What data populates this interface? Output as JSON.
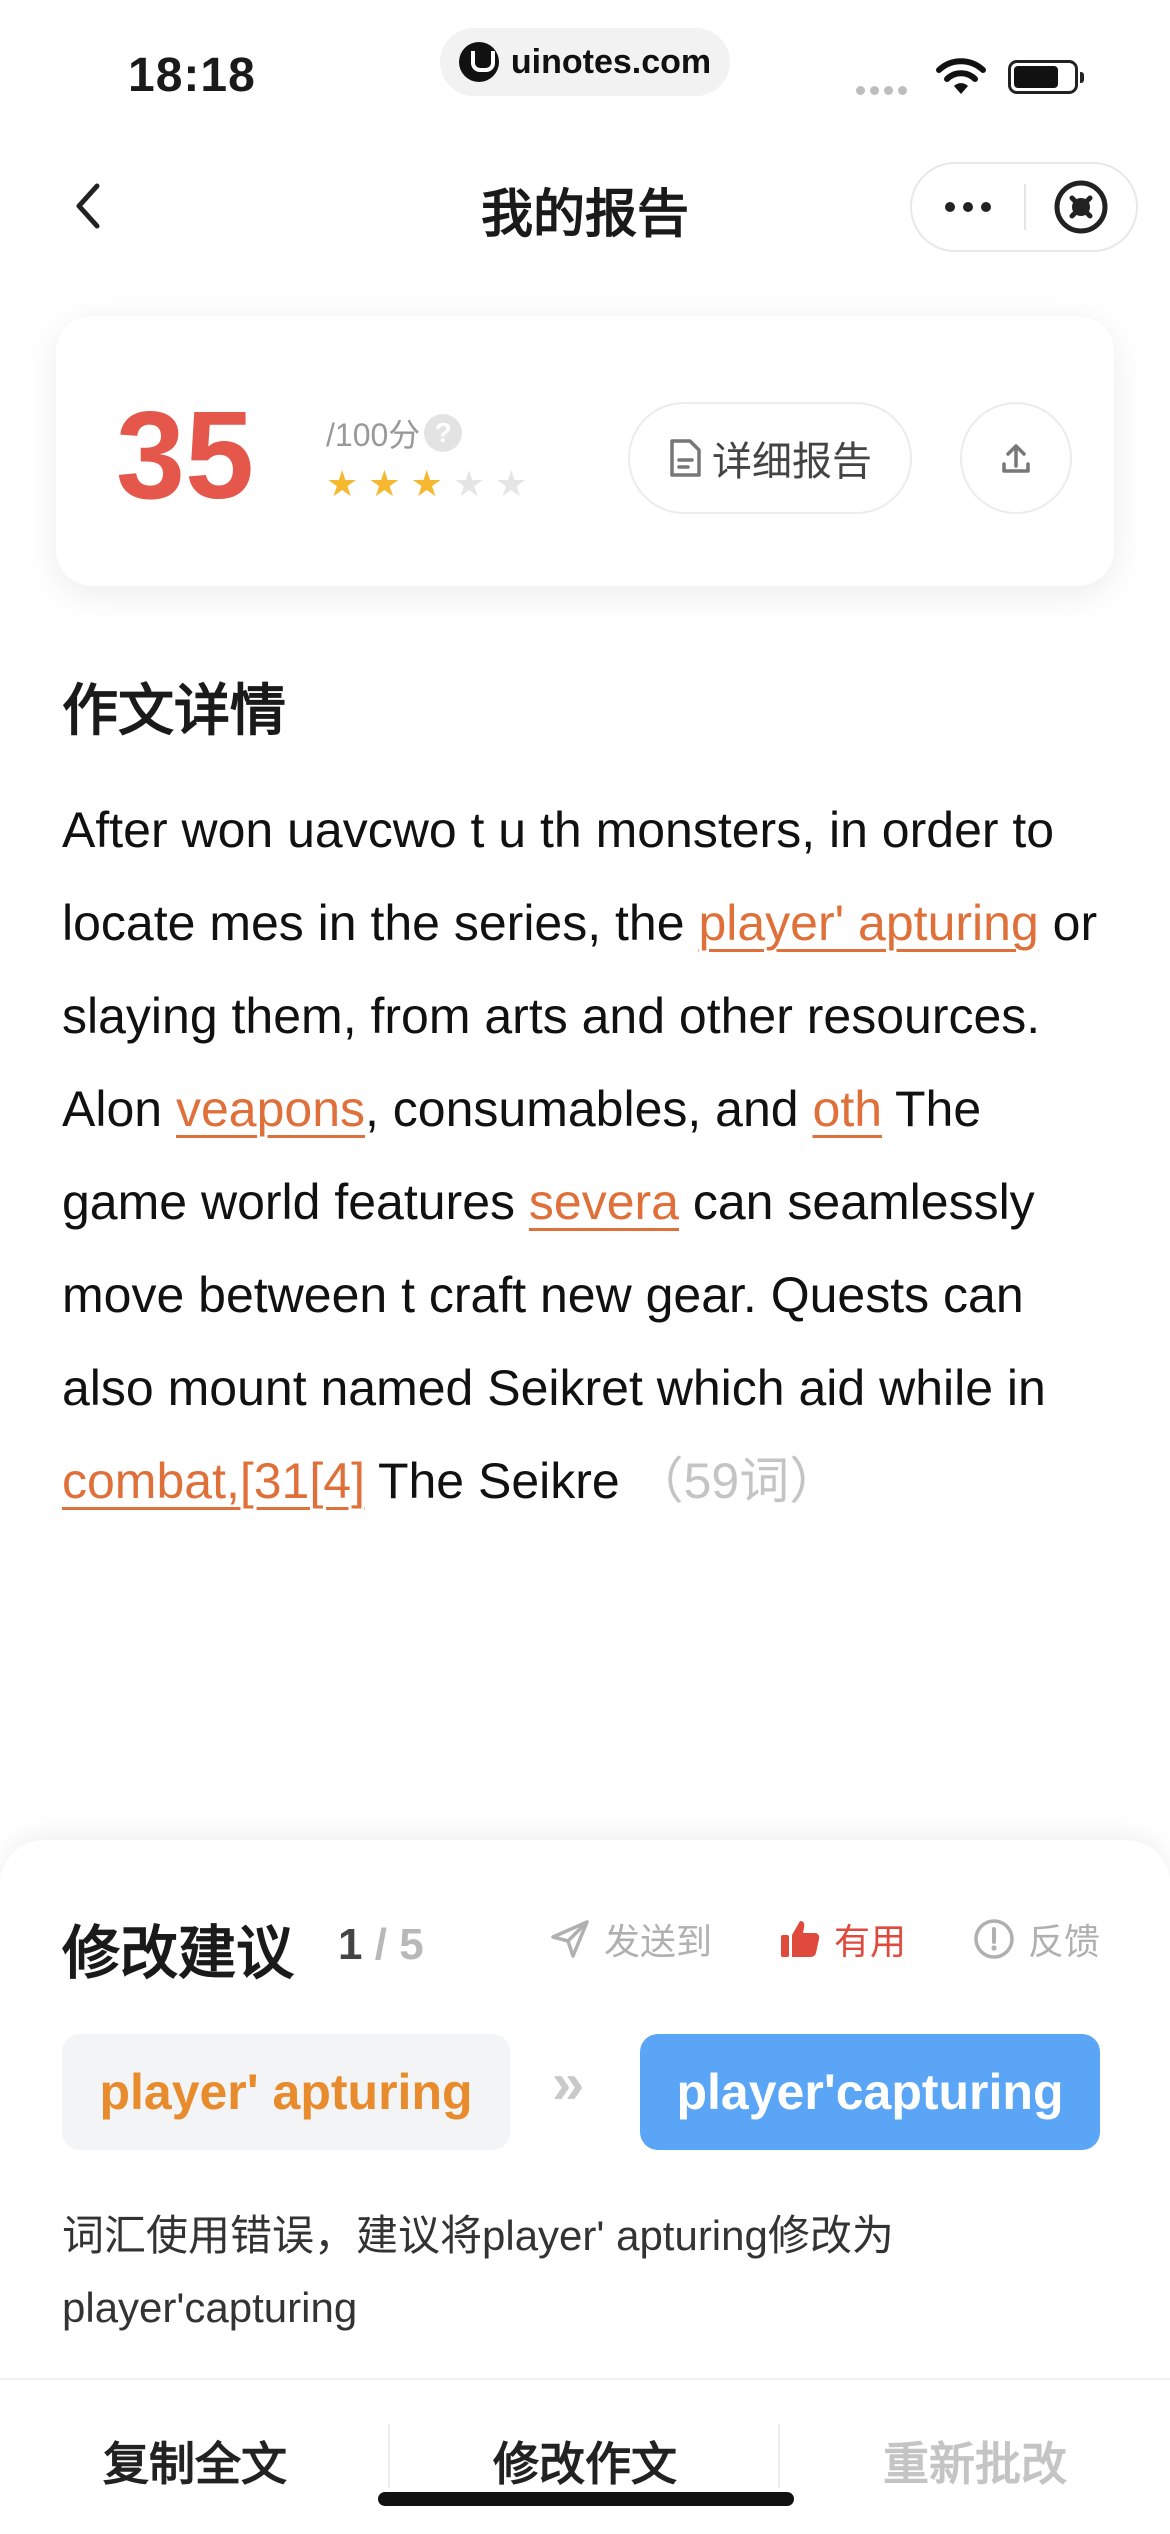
{
  "status_bar": {
    "time": "18:18",
    "url": "uinotes.com",
    "icons": [
      "cellular-signal-icon",
      "wifi-icon",
      "battery-icon"
    ]
  },
  "nav": {
    "title": "我的报告",
    "icons": [
      "chevron-left-icon",
      "more-icon",
      "close-circle-icon"
    ]
  },
  "score": {
    "value": "35",
    "max_label": "/100分",
    "help_symbol": "?",
    "stars_filled": 3,
    "stars_total": 5,
    "detail_button": "详细报告",
    "star_colors": {
      "filled": "#f5b82e",
      "empty": "#e5e5e5"
    }
  },
  "essay": {
    "title": "作文详情",
    "segments": [
      {
        "text": "After won uavcwo t u th monsters, in order to locate mes in the series, the ",
        "highlight": false
      },
      {
        "text": "player' apturing",
        "highlight": true
      },
      {
        "text": " or slaying them, from arts and other resources. Alon ",
        "highlight": false
      },
      {
        "text": "veapons",
        "highlight": true
      },
      {
        "text": ", consumables, and ",
        "highlight": false
      },
      {
        "text": "oth",
        "highlight": true
      },
      {
        "text": " The game world features ",
        "highlight": false
      },
      {
        "text": "severa",
        "highlight": true
      },
      {
        "text": " can seamlessly move between t craft new gear. Quests can also mount named Seikret which aid while in ",
        "highlight": false
      },
      {
        "text": "combat,[31[4]",
        "highlight": true
      },
      {
        "text": " The Seikre",
        "highlight": false
      }
    ],
    "word_count": "（59词）"
  },
  "suggestions": {
    "title": "修改建议",
    "current": "1",
    "separator": "/",
    "total": "5",
    "actions": {
      "send": "发送到",
      "useful": "有用",
      "feedback": "反馈"
    },
    "original": "player' apturing",
    "arrow": "»",
    "replacement": "player'capturing",
    "description": "词汇使用错误，建议将player' apturing修改为player'capturing"
  },
  "toolbar": {
    "copy": "复制全文",
    "edit": "修改作文",
    "redo": "重新批改"
  },
  "colors": {
    "score": "#e4574a",
    "highlight": "#e0703a",
    "accent_blue": "#5aa5f5",
    "useful_red": "#e04a3c"
  }
}
